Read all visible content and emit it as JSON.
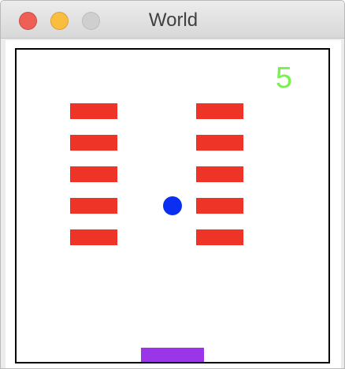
{
  "window": {
    "title": "World",
    "controls": [
      "close-button",
      "minimize-button",
      "zoom-button"
    ]
  },
  "game": {
    "score": "5",
    "colors": {
      "brick": "#ee3427",
      "ball": "#0a2ef2",
      "paddle": "#9a36e8",
      "score": "#78f04f",
      "border": "#000000"
    },
    "brick_layout": {
      "columns": 2,
      "rows": 5,
      "count": 10
    }
  }
}
